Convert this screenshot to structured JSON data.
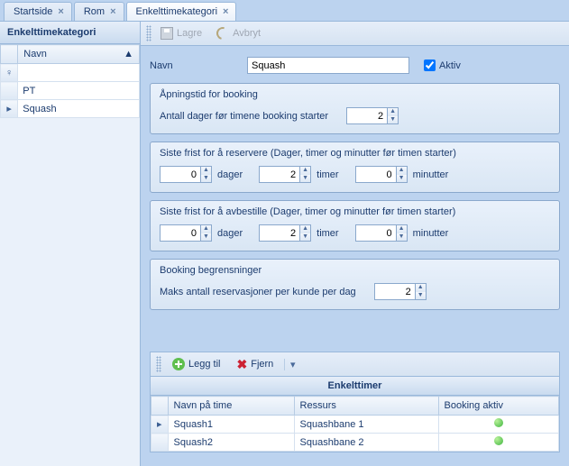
{
  "tabs": [
    {
      "label": "Startside"
    },
    {
      "label": "Rom"
    },
    {
      "label": "Enkelttimekategori"
    }
  ],
  "sidebar": {
    "title": "Enkelttimekategori",
    "col": "Navn",
    "rows": [
      "PT",
      "Squash"
    ]
  },
  "toolbar": {
    "save": "Lagre",
    "cancel": "Avbryt"
  },
  "form": {
    "name_label": "Navn",
    "name_value": "Squash",
    "active_label": "Aktiv",
    "active_checked": true
  },
  "opening": {
    "legend": "Åpningstid for booking",
    "label": "Antall dager før timene booking starter",
    "value": "2"
  },
  "reserve": {
    "legend": "Siste frist for å reservere (Dager, timer og minutter før timen starter)",
    "days": "0",
    "days_unit": "dager",
    "hours": "2",
    "hours_unit": "timer",
    "mins": "0",
    "mins_unit": "minutter"
  },
  "cancel": {
    "legend": "Siste frist for å avbestille (Dager, timer og minutter før timen starter)",
    "days": "0",
    "days_unit": "dager",
    "hours": "2",
    "hours_unit": "timer",
    "mins": "0",
    "mins_unit": "minutter"
  },
  "limits": {
    "legend": "Booking begrensninger",
    "label": "Maks antall reservasjoner per kunde per dag",
    "value": "2"
  },
  "subtoolbar": {
    "add": "Legg til",
    "remove": "Fjern"
  },
  "grid": {
    "title": "Enkelttimer",
    "cols": {
      "name": "Navn på time",
      "resource": "Ressurs",
      "active": "Booking aktiv"
    },
    "rows": [
      {
        "name": "Squash1",
        "resource": "Squashbane 1",
        "active": true
      },
      {
        "name": "Squash2",
        "resource": "Squashbane 2",
        "active": true
      }
    ]
  }
}
